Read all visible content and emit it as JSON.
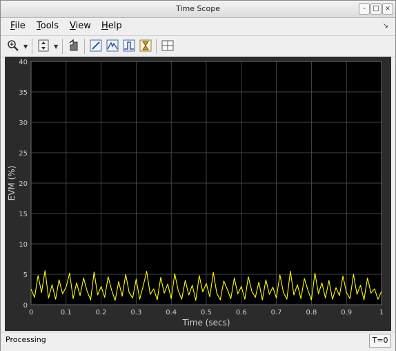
{
  "window": {
    "title": "Time Scope"
  },
  "titlebar_buttons": {
    "minimize": "-",
    "maximize": "□",
    "close": "×"
  },
  "menu": [
    {
      "label_u": "F",
      "label_rest": "ile"
    },
    {
      "label_u": "T",
      "label_rest": "ools"
    },
    {
      "label_u": "V",
      "label_rest": "iew"
    },
    {
      "label_u": "H",
      "label_rest": "elp"
    }
  ],
  "menu_dock_icon": "↘",
  "toolbar": {
    "icons": [
      "zoom-in-icon",
      "autoscale-icon",
      "restore-view-icon",
      "triggers-icon",
      "peak-finder-icon",
      "cursor-measurements-icon",
      "signal-statistics-icon",
      "layout-icon"
    ]
  },
  "status": {
    "text": "Processing",
    "time": "T=0"
  },
  "chart_data": {
    "type": "line",
    "xlabel": "Time (secs)",
    "ylabel": "EVM (%)",
    "xlim": [
      0,
      1
    ],
    "ylim": [
      0,
      40
    ],
    "xticks": [
      "0",
      "0.1",
      "0.2",
      "0.3",
      "0.4",
      "0.5",
      "0.6",
      "0.7",
      "0.8",
      "0.9",
      "1"
    ],
    "yticks": [
      "0",
      "5",
      "10",
      "15",
      "20",
      "25",
      "30",
      "35",
      "40"
    ],
    "grid": true,
    "background": "#000000",
    "axes_color": "#2b2b2b",
    "line_color": "#ffff00",
    "series": [
      {
        "description": "noisy EVM trace around ~2.5% ranging roughly 0.5–5.8%",
        "x": [
          0,
          0.01,
          0.02,
          0.03,
          0.04,
          0.05,
          0.06,
          0.07,
          0.08,
          0.09,
          0.1,
          0.11,
          0.12,
          0.13,
          0.14,
          0.15,
          0.16,
          0.17,
          0.18,
          0.19,
          0.2,
          0.21,
          0.22,
          0.23,
          0.24,
          0.25,
          0.26,
          0.27,
          0.28,
          0.29,
          0.3,
          0.31,
          0.32,
          0.33,
          0.34,
          0.35,
          0.36,
          0.37,
          0.38,
          0.39,
          0.4,
          0.41,
          0.42,
          0.43,
          0.44,
          0.45,
          0.46,
          0.47,
          0.48,
          0.49,
          0.5,
          0.51,
          0.52,
          0.53,
          0.54,
          0.55,
          0.56,
          0.57,
          0.58,
          0.59,
          0.6,
          0.61,
          0.62,
          0.63,
          0.64,
          0.65,
          0.66,
          0.67,
          0.68,
          0.69,
          0.7,
          0.71,
          0.72,
          0.73,
          0.74,
          0.75,
          0.76,
          0.77,
          0.78,
          0.79,
          0.8,
          0.81,
          0.82,
          0.83,
          0.84,
          0.85,
          0.86,
          0.87,
          0.88,
          0.89,
          0.9,
          0.91,
          0.92,
          0.93,
          0.94,
          0.95,
          0.96,
          0.97,
          0.98,
          0.99,
          1
        ],
        "y": [
          2.6,
          1.2,
          4.8,
          2.0,
          5.6,
          1.1,
          3.3,
          0.9,
          4.1,
          1.8,
          2.9,
          5.2,
          1.0,
          3.6,
          1.5,
          4.4,
          2.2,
          0.8,
          5.4,
          1.6,
          3.0,
          1.2,
          4.6,
          2.4,
          0.7,
          3.8,
          1.4,
          5.0,
          2.0,
          1.1,
          4.2,
          0.9,
          3.1,
          5.5,
          1.7,
          2.6,
          0.8,
          4.5,
          1.9,
          3.4,
          1.0,
          5.1,
          2.3,
          0.9,
          4.0,
          1.6,
          3.2,
          0.7,
          4.8,
          2.1,
          3.5,
          1.3,
          5.3,
          1.9,
          0.8,
          3.9,
          2.5,
          1.0,
          4.4,
          1.8,
          3.0,
          0.9,
          4.6,
          2.2,
          1.2,
          3.7,
          0.8,
          4.1,
          1.7,
          2.9,
          1.1,
          4.9,
          2.0,
          0.9,
          5.5,
          1.6,
          3.3,
          1.0,
          4.3,
          2.4,
          0.8,
          5.2,
          1.8,
          3.6,
          1.1,
          4.0,
          0.9,
          2.8,
          1.5,
          4.7,
          2.0,
          1.0,
          5.0,
          1.7,
          3.2,
          0.8,
          4.4,
          1.9,
          2.6,
          0.9,
          2.2
        ]
      }
    ]
  }
}
